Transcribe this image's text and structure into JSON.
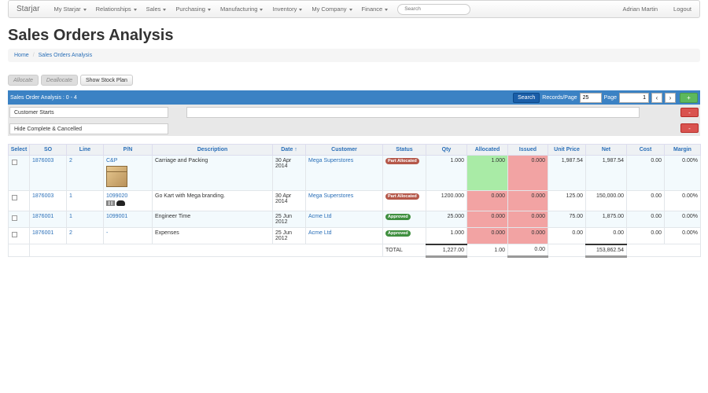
{
  "nav": {
    "brand": "Starjar",
    "menus": [
      "My Starjar",
      "Relationships",
      "Sales",
      "Purchasing",
      "Manufacturing",
      "Inventory",
      "My Company",
      "Finance"
    ],
    "search_placeholder": "Search",
    "user": "Adrian Martin",
    "logout": "Logout"
  },
  "page": {
    "title": "Sales Orders Analysis",
    "breadcrumb": [
      "Home",
      "Sales Orders Analysis"
    ]
  },
  "actions": {
    "allocate": "Allocate",
    "deallocate": "Deallocate",
    "show_stock_plan": "Show Stock Plan"
  },
  "toolbar": {
    "summary": "Sales Order Analysis : 0 - 4",
    "search_label": "Search",
    "records_label": "Records/Page",
    "records_value": "25",
    "page_label": "Page",
    "page_value": "1",
    "prev": "‹",
    "next": "›",
    "add": "+"
  },
  "filters": {
    "filter1": "Customer Starts",
    "filter2": "Hide Complete & Cancelled",
    "remove": "-"
  },
  "table": {
    "headers": [
      "Select",
      "SO",
      "Line",
      "P/N",
      "Description",
      "Date ↑",
      "Customer",
      "Status",
      "Qty",
      "Allocated",
      "Issued",
      "Unit Price",
      "Net",
      "Cost",
      "Margin"
    ],
    "rows": [
      {
        "so": "1876003",
        "line": "2",
        "pn": "C&P",
        "desc": "Carriage and Packing",
        "date": "30 Apr 2014",
        "customer": "Mega Superstores",
        "status": "Part Allocated",
        "qty": "1.000",
        "allocated": "1.000",
        "issued": "0.000",
        "unit_price": "1,987.54",
        "net": "1,987.54",
        "cost": "0.00",
        "margin": "0.00%"
      },
      {
        "so": "1876003",
        "line": "1",
        "pn": "1099020",
        "desc": "Go Kart with Mega branding.",
        "date": "30 Apr 2014",
        "customer": "Mega Superstores",
        "status": "Part Allocated",
        "qty": "1200.000",
        "allocated": "0.000",
        "issued": "0.000",
        "unit_price": "125.00",
        "net": "150,000.00",
        "cost": "0.00",
        "margin": "0.00%"
      },
      {
        "so": "1876001",
        "line": "1",
        "pn": "1099001",
        "desc": "Engineer Time",
        "date": "25 Jun 2012",
        "customer": "Acme Ltd",
        "status": "Approved",
        "qty": "25.000",
        "allocated": "0.000",
        "issued": "0.000",
        "unit_price": "75.00",
        "net": "1,875.00",
        "cost": "0.00",
        "margin": "0.00%"
      },
      {
        "so": "1876001",
        "line": "2",
        "pn": "-",
        "desc": "Expenses",
        "date": "25 Jun 2012",
        "customer": "Acme Ltd",
        "status": "Approved",
        "qty": "1.000",
        "allocated": "0.000",
        "issued": "0.000",
        "unit_price": "0.00",
        "net": "0.00",
        "cost": "0.00",
        "margin": "0.00%"
      }
    ],
    "total": {
      "label": "TOTAL",
      "qty": "1,227.00",
      "allocated": "1.00",
      "issued": "0.00",
      "net": "153,862.54"
    }
  }
}
